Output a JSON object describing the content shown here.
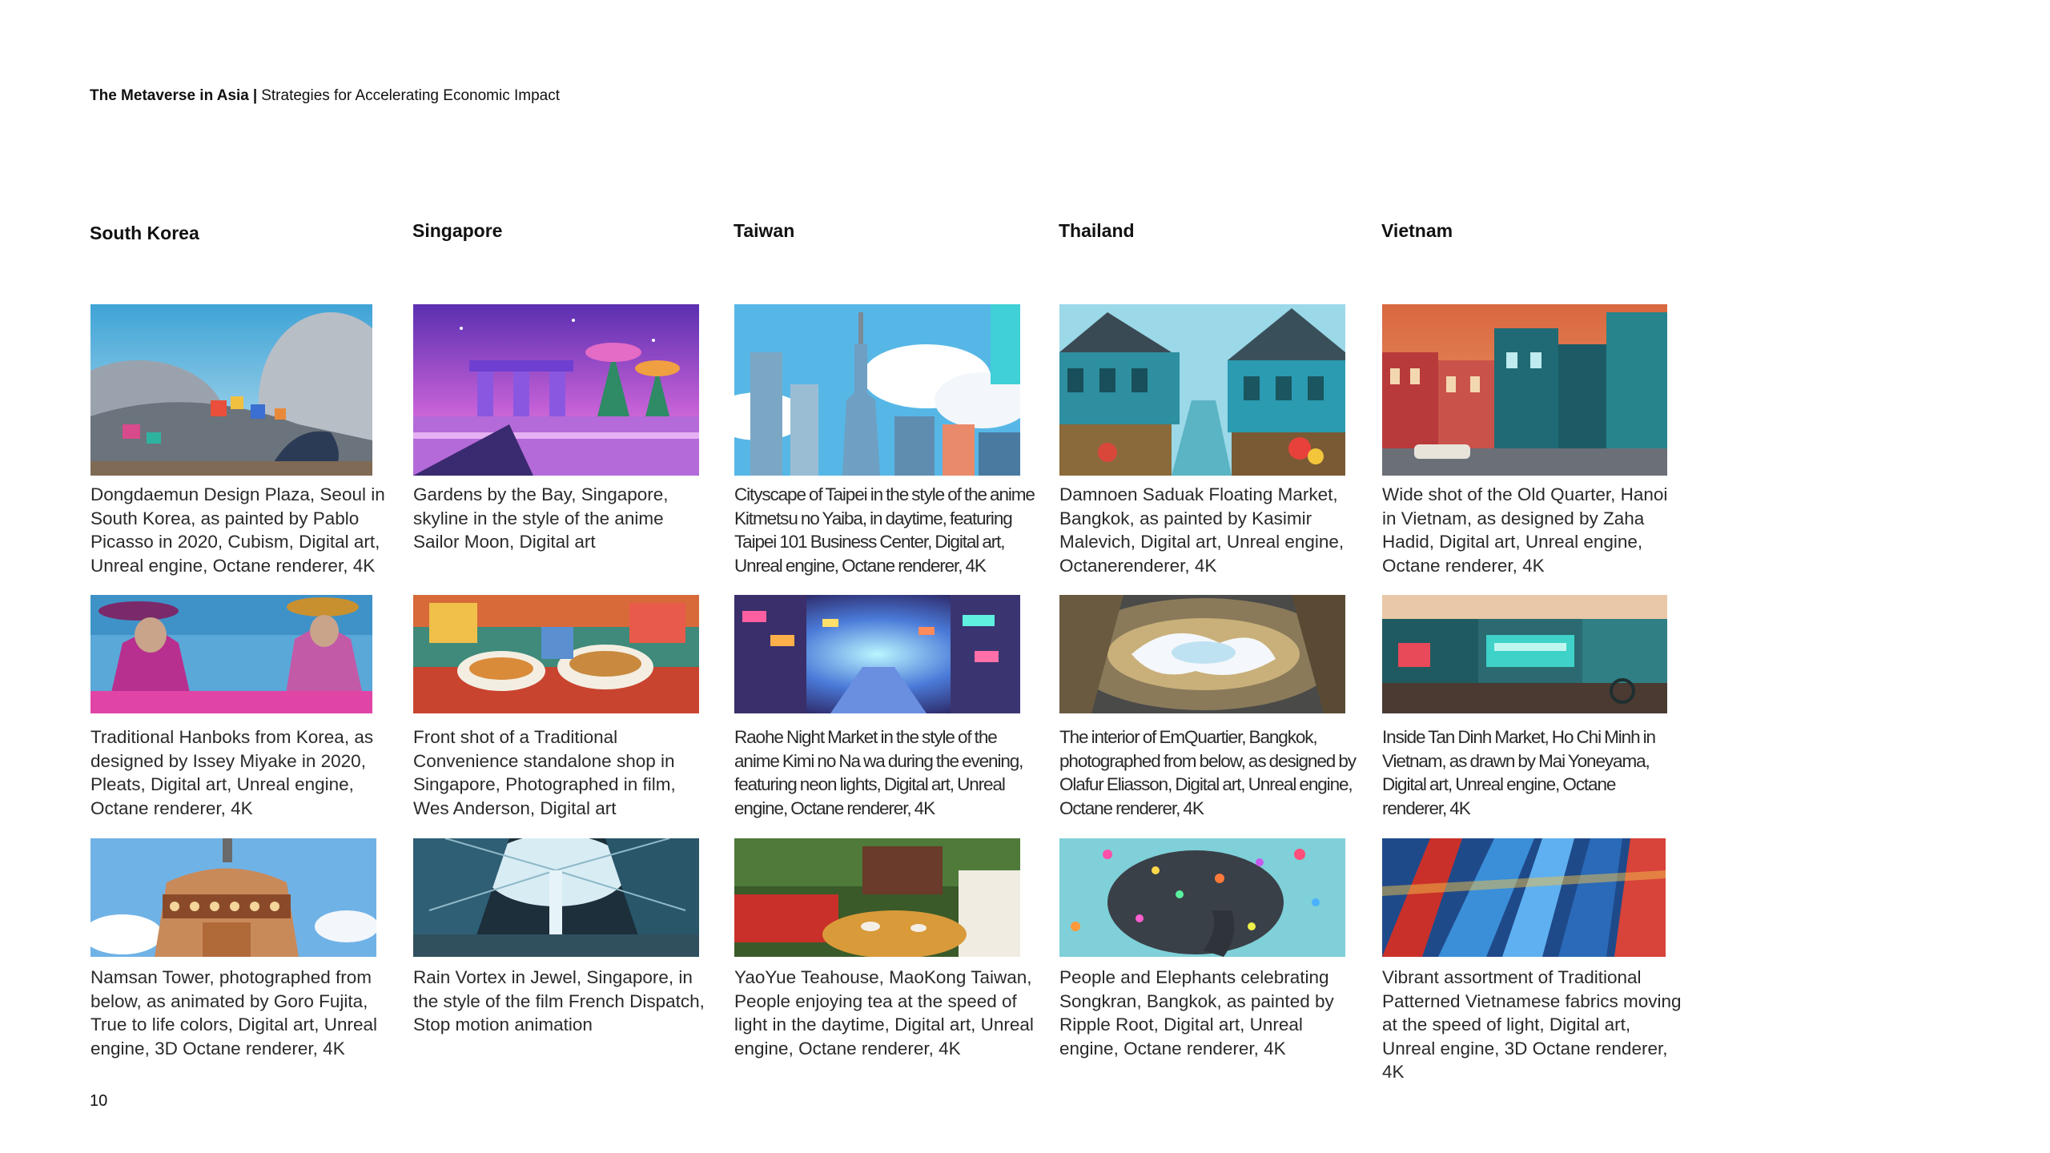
{
  "header": {
    "title": "The Metaverse in Asia",
    "separator": "|",
    "subtitle": "Strategies for Accelerating Economic Impact"
  },
  "columns": [
    {
      "title": "South Korea",
      "items": [
        {
          "caption": "Dongdaemun Design Plaza, Seoul in South Korea, as painted by Pablo Picasso in 2020, Cubism, Digital art, Unreal engine, Octane renderer, 4K"
        },
        {
          "caption": "Traditional Hanboks from Korea, as designed by Issey Miyake in 2020, Pleats, Digital art, Unreal engine, Octane renderer, 4K"
        },
        {
          "caption": "Namsan Tower, photographed from below, as animated by Goro Fujita, True to life colors, Digital art, Unreal engine, 3D Octane renderer, 4K"
        }
      ]
    },
    {
      "title": "Singapore",
      "items": [
        {
          "caption": "Gardens by the Bay, Singapore, skyline in the style of the anime Sailor Moon, Digital art"
        },
        {
          "caption": "Front shot of a Traditional Convenience standalone shop in Singapore, Photographed in film, Wes Anderson, Digital art"
        },
        {
          "caption": "Rain Vortex in Jewel, Singapore, in the style of the film French Dispatch, Stop motion animation"
        }
      ]
    },
    {
      "title": "Taiwan",
      "items": [
        {
          "caption": "Cityscape of Taipei in the style of the anime Kitmetsu no Yaiba, in daytime, featuring Taipei 101 Business Center, Digital art, Unreal engine, Octane renderer, 4K"
        },
        {
          "caption": "Raohe Night Market in the style of the anime Kimi no Na wa during the evening, featuring neon lights, Digital art, Unreal engine, Octane renderer, 4K"
        },
        {
          "caption": "YaoYue Teahouse, MaoKong Taiwan, People enjoying tea at the speed of light in the daytime, Digital art, Unreal engine, Octane renderer, 4K"
        }
      ]
    },
    {
      "title": "Thailand",
      "items": [
        {
          "caption": "Damnoen Saduak Floating Market, Bangkok, as painted by Kasimir Malevich, Digital art, Unreal engine, Octanerenderer, 4K"
        },
        {
          "caption": "The interior of EmQuartier, Bangkok, photographed from below, as designed by Olafur Eliasson, Digital art, Unreal engine, Octane renderer, 4K"
        },
        {
          "caption": "People and Elephants celebrating Songkran, Bangkok, as painted by Ripple Root, Digital art, Unreal engine, Octane renderer, 4K"
        }
      ]
    },
    {
      "title": "Vietnam",
      "items": [
        {
          "caption": "Wide shot of the Old Quarter, Hanoi in Vietnam, as designed by Zaha Hadid, Digital art, Unreal engine, Octane renderer, 4K"
        },
        {
          "caption": "Inside Tan Dinh Market, Ho Chi Minh in Vietnam, as drawn by Mai Yoneyama, Digital art, Unreal engine, Octane renderer, 4K"
        },
        {
          "caption": "Vibrant assortment of Traditional Patterned Vietnamese fabrics moving at the speed of light, Digital art, Unreal engine, 3D Octane renderer, 4K"
        }
      ]
    }
  ],
  "page_number": "10"
}
